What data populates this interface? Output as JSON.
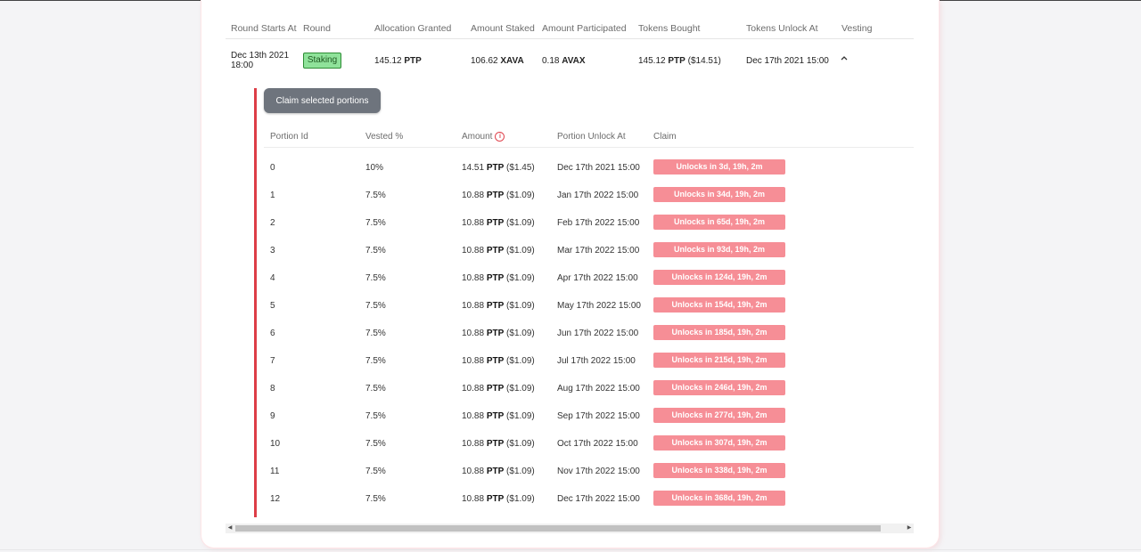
{
  "header": {
    "columns": [
      "Round Starts At",
      "Round",
      "Allocation Granted",
      "Amount Staked",
      "Amount Participated",
      "Tokens Bought",
      "Tokens Unlock At",
      "Vesting"
    ]
  },
  "round": {
    "starts_date": "Dec 13th 2021",
    "starts_time": "18:00",
    "badge": "Staking",
    "allocation_value": "145.12",
    "allocation_token": "PTP",
    "staked_value": "106.62",
    "staked_token": "XAVA",
    "participated_value": "0.18",
    "participated_token": "AVAX",
    "bought_value": "145.12",
    "bought_token": "PTP",
    "bought_usd": "($14.51)",
    "unlock_at": "Dec 17th 2021 15:00",
    "vesting_toggle_icon": "chevron-up-icon"
  },
  "vesting": {
    "claim_button": "Claim selected portions",
    "columns": [
      "Portion Id",
      "Vested %",
      "Amount",
      "Portion Unlock At",
      "Claim"
    ],
    "amount_info_icon": "info-icon",
    "token": "PTP",
    "portions": [
      {
        "id": "0",
        "vested": "10%",
        "amount": "14.51",
        "usd": "($1.45)",
        "unlock": "Dec 17th 2021 15:00",
        "claim": "Unlocks in 3d, 19h, 2m"
      },
      {
        "id": "1",
        "vested": "7.5%",
        "amount": "10.88",
        "usd": "($1.09)",
        "unlock": "Jan 17th 2022 15:00",
        "claim": "Unlocks in 34d, 19h, 2m"
      },
      {
        "id": "2",
        "vested": "7.5%",
        "amount": "10.88",
        "usd": "($1.09)",
        "unlock": "Feb 17th 2022 15:00",
        "claim": "Unlocks in 65d, 19h, 2m"
      },
      {
        "id": "3",
        "vested": "7.5%",
        "amount": "10.88",
        "usd": "($1.09)",
        "unlock": "Mar 17th 2022 15:00",
        "claim": "Unlocks in 93d, 19h, 2m"
      },
      {
        "id": "4",
        "vested": "7.5%",
        "amount": "10.88",
        "usd": "($1.09)",
        "unlock": "Apr 17th 2022 15:00",
        "claim": "Unlocks in 124d, 19h, 2m"
      },
      {
        "id": "5",
        "vested": "7.5%",
        "amount": "10.88",
        "usd": "($1.09)",
        "unlock": "May 17th 2022 15:00",
        "claim": "Unlocks in 154d, 19h, 2m"
      },
      {
        "id": "6",
        "vested": "7.5%",
        "amount": "10.88",
        "usd": "($1.09)",
        "unlock": "Jun 17th 2022 15:00",
        "claim": "Unlocks in 185d, 19h, 2m"
      },
      {
        "id": "7",
        "vested": "7.5%",
        "amount": "10.88",
        "usd": "($1.09)",
        "unlock": "Jul 17th 2022 15:00",
        "claim": "Unlocks in 215d, 19h, 2m"
      },
      {
        "id": "8",
        "vested": "7.5%",
        "amount": "10.88",
        "usd": "($1.09)",
        "unlock": "Aug 17th 2022 15:00",
        "claim": "Unlocks in 246d, 19h, 2m"
      },
      {
        "id": "9",
        "vested": "7.5%",
        "amount": "10.88",
        "usd": "($1.09)",
        "unlock": "Sep 17th 2022 15:00",
        "claim": "Unlocks in 277d, 19h, 2m"
      },
      {
        "id": "10",
        "vested": "7.5%",
        "amount": "10.88",
        "usd": "($1.09)",
        "unlock": "Oct 17th 2022 15:00",
        "claim": "Unlocks in 307d, 19h, 2m"
      },
      {
        "id": "11",
        "vested": "7.5%",
        "amount": "10.88",
        "usd": "($1.09)",
        "unlock": "Nov 17th 2022 15:00",
        "claim": "Unlocks in 338d, 19h, 2m"
      },
      {
        "id": "12",
        "vested": "7.5%",
        "amount": "10.88",
        "usd": "($1.09)",
        "unlock": "Dec 17th 2022 15:00",
        "claim": "Unlocks in 368d, 19h, 2m"
      }
    ]
  },
  "colors": {
    "accent_red": "#dd3d47",
    "unlock_button": "#f68e96",
    "badge_green": "#8fe29a",
    "claim_button": "#6e747d"
  },
  "scrollbar": {
    "left_arrow_icon": "scroll-left-icon",
    "right_arrow_icon": "scroll-right-icon"
  }
}
